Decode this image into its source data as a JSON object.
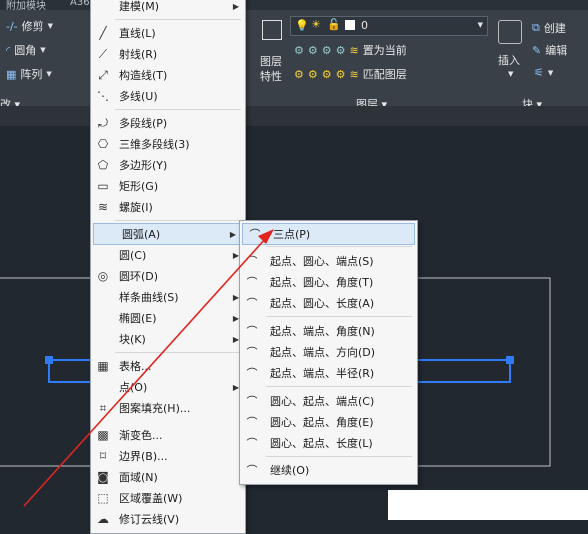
{
  "ribbon": {
    "top_tabs": [
      "附加模块",
      "A36"
    ],
    "modify": {
      "trim": "修剪",
      "fillet": "圆角",
      "array": "阵列"
    },
    "panel_edit_label": "改 ▾",
    "layer": {
      "current_layer": "0",
      "layer_properties": "图层\n特性",
      "set_current": "置为当前",
      "match_layer": "匹配图层",
      "panel_label": "图层 ▾"
    },
    "block": {
      "insert": "插入",
      "create": "创建",
      "edit": "编辑",
      "panel_label": "块 ▾"
    }
  },
  "draw_menu": {
    "items": [
      {
        "label": "建模(M)",
        "icon": "modeling-icon",
        "submenu": true
      },
      {
        "label": "直线(L)",
        "icon": "line-icon"
      },
      {
        "label": "射线(R)",
        "icon": "ray-icon"
      },
      {
        "label": "构造线(T)",
        "icon": "xline-icon"
      },
      {
        "label": "多线(U)",
        "icon": "mline-icon"
      },
      {
        "label": "多段线(P)",
        "icon": "polyline-icon"
      },
      {
        "label": "三维多段线(3)",
        "icon": "3dpoly-icon"
      },
      {
        "label": "多边形(Y)",
        "icon": "polygon-icon"
      },
      {
        "label": "矩形(G)",
        "icon": "rectangle-icon"
      },
      {
        "label": "螺旋(I)",
        "icon": "helix-icon"
      },
      {
        "label": "圆弧(A)",
        "icon": "",
        "submenu": true
      },
      {
        "label": "圆(C)",
        "icon": "",
        "submenu": true
      },
      {
        "label": "圆环(D)",
        "icon": "donut-icon"
      },
      {
        "label": "样条曲线(S)",
        "icon": "",
        "submenu": true
      },
      {
        "label": "椭圆(E)",
        "icon": "",
        "submenu": true
      },
      {
        "label": "块(K)",
        "icon": "",
        "submenu": true
      },
      {
        "label": "表格...",
        "icon": "table-icon"
      },
      {
        "label": "点(O)",
        "icon": "",
        "submenu": true
      },
      {
        "label": "图案填充(H)...",
        "icon": "hatch-icon"
      },
      {
        "label": "渐变色...",
        "icon": "gradient-icon"
      },
      {
        "label": "边界(B)...",
        "icon": "boundary-icon"
      },
      {
        "label": "面域(N)",
        "icon": "region-icon"
      },
      {
        "label": "区域覆盖(W)",
        "icon": "wipeout-icon"
      },
      {
        "label": "修订云线(V)",
        "icon": "revcloud-icon"
      }
    ]
  },
  "arc_menu": {
    "items": [
      "三点(P)",
      "起点、圆心、端点(S)",
      "起点、圆心、角度(T)",
      "起点、圆心、长度(A)",
      "起点、端点、角度(N)",
      "起点、端点、方向(D)",
      "起点、端点、半径(R)",
      "圆心、起点、端点(C)",
      "圆心、起点、角度(E)",
      "圆心、起点、长度(L)",
      "继续(O)"
    ]
  },
  "colors": {
    "accent_arrow": "#e0251f",
    "selection": "#2f7cf6",
    "canvas": "#212830"
  }
}
